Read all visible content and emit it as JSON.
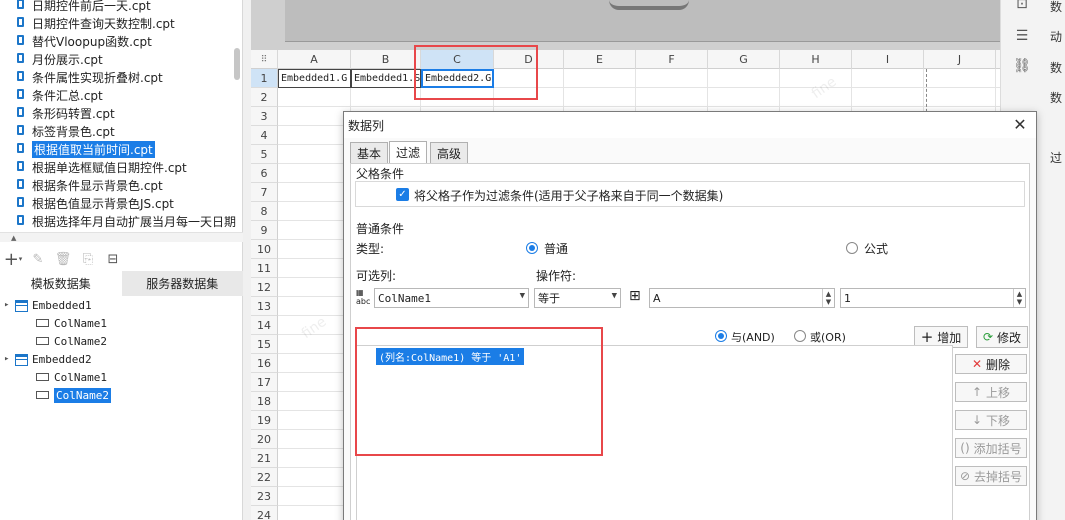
{
  "file_list": [
    {
      "name": "日期控件前后一天.cpt",
      "selected": false
    },
    {
      "name": "日期控件查询天数控制.cpt",
      "selected": false
    },
    {
      "name": "替代Vloopup函数.cpt",
      "selected": false
    },
    {
      "name": "月份展示.cpt",
      "selected": false
    },
    {
      "name": "条件属性实现折叠树.cpt",
      "selected": false
    },
    {
      "name": "条件汇总.cpt",
      "selected": false
    },
    {
      "name": "条形码转置.cpt",
      "selected": false
    },
    {
      "name": "标签背景色.cpt",
      "selected": false
    },
    {
      "name": "根据值取当前时间.cpt",
      "selected": true
    },
    {
      "name": "根据单选框赋值日期控件.cpt",
      "selected": false
    },
    {
      "name": "根据条件显示背景色.cpt",
      "selected": false
    },
    {
      "name": "根据色值显示背景色JS.cpt",
      "selected": false
    },
    {
      "name": "根据选择年月自动扩展当月每一天日期",
      "selected": false
    }
  ],
  "dataset_tabs": [
    "模板数据集",
    "服务器数据集"
  ],
  "dataset_tree": [
    {
      "label": "Embedded1",
      "level": 0,
      "type": "ds",
      "selected": false
    },
    {
      "label": "ColName1",
      "level": 1,
      "type": "col",
      "selected": false
    },
    {
      "label": "ColName2",
      "level": 1,
      "type": "col",
      "selected": false
    },
    {
      "label": "Embedded2",
      "level": 0,
      "type": "ds",
      "selected": false
    },
    {
      "label": "ColName1",
      "level": 1,
      "type": "col",
      "selected": false
    },
    {
      "label": "ColName2",
      "level": 1,
      "type": "col",
      "selected": true
    }
  ],
  "sheet": {
    "columns": [
      "A",
      "B",
      "C",
      "D",
      "E",
      "F",
      "G",
      "H",
      "I",
      "J"
    ],
    "rows": [
      "1",
      "2",
      "3",
      "4",
      "5",
      "6",
      "7",
      "8",
      "9",
      "10",
      "11",
      "12",
      "13",
      "14",
      "15",
      "16",
      "17",
      "18",
      "19",
      "20",
      "21",
      "22",
      "23",
      "24"
    ],
    "cells": {
      "A1": "Embedded1.G",
      "B1": "Embedded1.S",
      "C1": "Embedded2.G"
    },
    "active_column": "C",
    "active_row": "1"
  },
  "right_panel": [
    "数",
    "动",
    "数",
    "数",
    "过"
  ],
  "dialog": {
    "title": "数据列",
    "tabs": [
      "基本",
      "过滤",
      "高级"
    ],
    "active_tab": "过滤",
    "parent_group_title": "父格条件",
    "parent_checkbox_label": "将父格子作为过滤条件(适用于父子格来自于同一个数据集)",
    "normal_group_title": "普通条件",
    "type_label": "类型:",
    "type_normal": "普通",
    "type_formula": "公式",
    "column_label": "可选列:",
    "operator_label": "操作符:",
    "column_value": "ColName1",
    "operator_value": "等于",
    "value_a": "A",
    "value_b": "1",
    "and_label": "与(AND)",
    "or_label": "或(OR)",
    "add_button": "增加",
    "modify_button": "修改",
    "delete_button": "删除",
    "up_button": "上移",
    "down_button": "下移",
    "add_bracket_button": "添加括号",
    "remove_bracket_button": "去掉括号",
    "condition_item": "(列名:ColName1) 等于 'A1'"
  }
}
